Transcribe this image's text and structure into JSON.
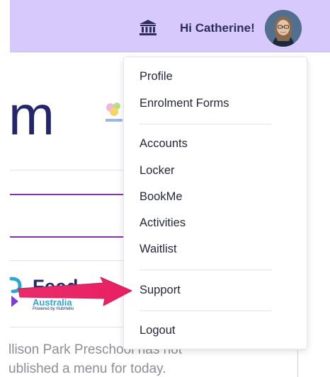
{
  "header": {
    "greeting": "Hi Catherine!",
    "icons": {
      "institution": "bank-icon",
      "avatar": "avatar"
    },
    "background_color": "#d7c9fb"
  },
  "background": {
    "heading_fragment": "m",
    "feed_logo": {
      "word": "Feed",
      "subtitle": "Australia",
      "powered_by": "Powered by HubHello"
    },
    "message_lines": [
      "llison Park Preschool has not",
      "ublished a menu for today."
    ]
  },
  "menu": {
    "items": [
      {
        "label": "Profile"
      },
      {
        "label": "Enrolment Forms"
      },
      {
        "label": "Accounts"
      },
      {
        "label": "Locker"
      },
      {
        "label": "BookMe"
      },
      {
        "label": "Activities"
      },
      {
        "label": "Waitlist"
      },
      {
        "label": "Support"
      },
      {
        "label": "Logout"
      }
    ]
  },
  "annotation": {
    "color": "#ec2b6a",
    "points_to": "Support"
  }
}
